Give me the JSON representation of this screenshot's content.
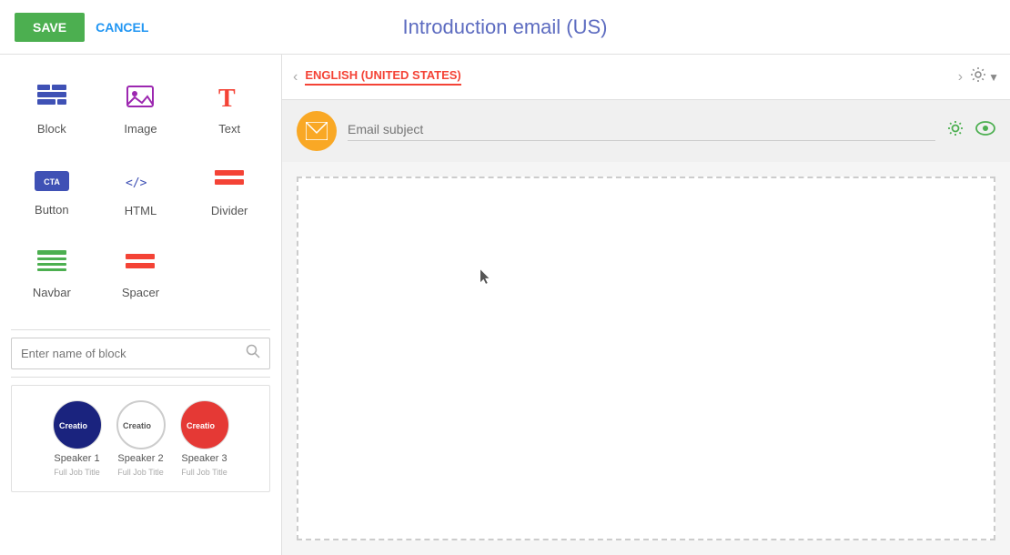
{
  "header": {
    "save_label": "SAVE",
    "cancel_label": "CANCEL",
    "title": "Introduction email (US)"
  },
  "sidebar": {
    "items": [
      {
        "id": "block",
        "label": "Block",
        "icon": "block"
      },
      {
        "id": "image",
        "label": "Image",
        "icon": "image"
      },
      {
        "id": "text",
        "label": "Text",
        "icon": "text"
      },
      {
        "id": "button",
        "label": "Button",
        "icon": "button"
      },
      {
        "id": "html",
        "label": "HTML",
        "icon": "html"
      },
      {
        "id": "divider",
        "label": "Divider",
        "icon": "divider"
      },
      {
        "id": "navbar",
        "label": "Navbar",
        "icon": "navbar"
      },
      {
        "id": "spacer",
        "label": "Spacer",
        "icon": "spacer"
      }
    ],
    "search_placeholder": "Enter name of block",
    "speakers": [
      {
        "name": "Speaker 1",
        "title": "Full Job Title",
        "avatar_class": "avatar-1",
        "initials": "Creatio"
      },
      {
        "name": "Speaker 2",
        "title": "Full Job Title",
        "avatar_class": "avatar-2",
        "initials": "Creatio"
      },
      {
        "name": "Speaker 3",
        "title": "Full Job Title",
        "avatar_class": "avatar-3",
        "initials": "Creatio"
      }
    ]
  },
  "lang_bar": {
    "language": "ENGLISH (UNITED STATES)"
  },
  "email": {
    "subject_placeholder": "Email subject"
  },
  "colors": {
    "save_bg": "#4caf50",
    "cancel_color": "#2196f3",
    "title_color": "#5c6bc0",
    "lang_active_color": "#f44336",
    "gear_color": "#4caf50",
    "eye_color": "#4caf50",
    "email_icon_bg": "#f9a825"
  }
}
